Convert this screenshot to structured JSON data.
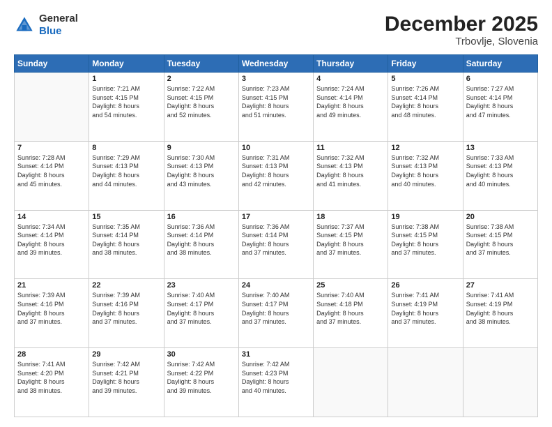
{
  "header": {
    "logo_line1": "General",
    "logo_line2": "Blue",
    "month_year": "December 2025",
    "location": "Trbovlje, Slovenia"
  },
  "days_of_week": [
    "Sunday",
    "Monday",
    "Tuesday",
    "Wednesday",
    "Thursday",
    "Friday",
    "Saturday"
  ],
  "weeks": [
    [
      {
        "day": "",
        "info": ""
      },
      {
        "day": "1",
        "info": "Sunrise: 7:21 AM\nSunset: 4:15 PM\nDaylight: 8 hours\nand 54 minutes."
      },
      {
        "day": "2",
        "info": "Sunrise: 7:22 AM\nSunset: 4:15 PM\nDaylight: 8 hours\nand 52 minutes."
      },
      {
        "day": "3",
        "info": "Sunrise: 7:23 AM\nSunset: 4:15 PM\nDaylight: 8 hours\nand 51 minutes."
      },
      {
        "day": "4",
        "info": "Sunrise: 7:24 AM\nSunset: 4:14 PM\nDaylight: 8 hours\nand 49 minutes."
      },
      {
        "day": "5",
        "info": "Sunrise: 7:26 AM\nSunset: 4:14 PM\nDaylight: 8 hours\nand 48 minutes."
      },
      {
        "day": "6",
        "info": "Sunrise: 7:27 AM\nSunset: 4:14 PM\nDaylight: 8 hours\nand 47 minutes."
      }
    ],
    [
      {
        "day": "7",
        "info": "Sunrise: 7:28 AM\nSunset: 4:14 PM\nDaylight: 8 hours\nand 45 minutes."
      },
      {
        "day": "8",
        "info": "Sunrise: 7:29 AM\nSunset: 4:13 PM\nDaylight: 8 hours\nand 44 minutes."
      },
      {
        "day": "9",
        "info": "Sunrise: 7:30 AM\nSunset: 4:13 PM\nDaylight: 8 hours\nand 43 minutes."
      },
      {
        "day": "10",
        "info": "Sunrise: 7:31 AM\nSunset: 4:13 PM\nDaylight: 8 hours\nand 42 minutes."
      },
      {
        "day": "11",
        "info": "Sunrise: 7:32 AM\nSunset: 4:13 PM\nDaylight: 8 hours\nand 41 minutes."
      },
      {
        "day": "12",
        "info": "Sunrise: 7:32 AM\nSunset: 4:13 PM\nDaylight: 8 hours\nand 40 minutes."
      },
      {
        "day": "13",
        "info": "Sunrise: 7:33 AM\nSunset: 4:13 PM\nDaylight: 8 hours\nand 40 minutes."
      }
    ],
    [
      {
        "day": "14",
        "info": "Sunrise: 7:34 AM\nSunset: 4:14 PM\nDaylight: 8 hours\nand 39 minutes."
      },
      {
        "day": "15",
        "info": "Sunrise: 7:35 AM\nSunset: 4:14 PM\nDaylight: 8 hours\nand 38 minutes."
      },
      {
        "day": "16",
        "info": "Sunrise: 7:36 AM\nSunset: 4:14 PM\nDaylight: 8 hours\nand 38 minutes."
      },
      {
        "day": "17",
        "info": "Sunrise: 7:36 AM\nSunset: 4:14 PM\nDaylight: 8 hours\nand 37 minutes."
      },
      {
        "day": "18",
        "info": "Sunrise: 7:37 AM\nSunset: 4:15 PM\nDaylight: 8 hours\nand 37 minutes."
      },
      {
        "day": "19",
        "info": "Sunrise: 7:38 AM\nSunset: 4:15 PM\nDaylight: 8 hours\nand 37 minutes."
      },
      {
        "day": "20",
        "info": "Sunrise: 7:38 AM\nSunset: 4:15 PM\nDaylight: 8 hours\nand 37 minutes."
      }
    ],
    [
      {
        "day": "21",
        "info": "Sunrise: 7:39 AM\nSunset: 4:16 PM\nDaylight: 8 hours\nand 37 minutes."
      },
      {
        "day": "22",
        "info": "Sunrise: 7:39 AM\nSunset: 4:16 PM\nDaylight: 8 hours\nand 37 minutes."
      },
      {
        "day": "23",
        "info": "Sunrise: 7:40 AM\nSunset: 4:17 PM\nDaylight: 8 hours\nand 37 minutes."
      },
      {
        "day": "24",
        "info": "Sunrise: 7:40 AM\nSunset: 4:17 PM\nDaylight: 8 hours\nand 37 minutes."
      },
      {
        "day": "25",
        "info": "Sunrise: 7:40 AM\nSunset: 4:18 PM\nDaylight: 8 hours\nand 37 minutes."
      },
      {
        "day": "26",
        "info": "Sunrise: 7:41 AM\nSunset: 4:19 PM\nDaylight: 8 hours\nand 37 minutes."
      },
      {
        "day": "27",
        "info": "Sunrise: 7:41 AM\nSunset: 4:19 PM\nDaylight: 8 hours\nand 38 minutes."
      }
    ],
    [
      {
        "day": "28",
        "info": "Sunrise: 7:41 AM\nSunset: 4:20 PM\nDaylight: 8 hours\nand 38 minutes."
      },
      {
        "day": "29",
        "info": "Sunrise: 7:42 AM\nSunset: 4:21 PM\nDaylight: 8 hours\nand 39 minutes."
      },
      {
        "day": "30",
        "info": "Sunrise: 7:42 AM\nSunset: 4:22 PM\nDaylight: 8 hours\nand 39 minutes."
      },
      {
        "day": "31",
        "info": "Sunrise: 7:42 AM\nSunset: 4:23 PM\nDaylight: 8 hours\nand 40 minutes."
      },
      {
        "day": "",
        "info": ""
      },
      {
        "day": "",
        "info": ""
      },
      {
        "day": "",
        "info": ""
      }
    ]
  ]
}
